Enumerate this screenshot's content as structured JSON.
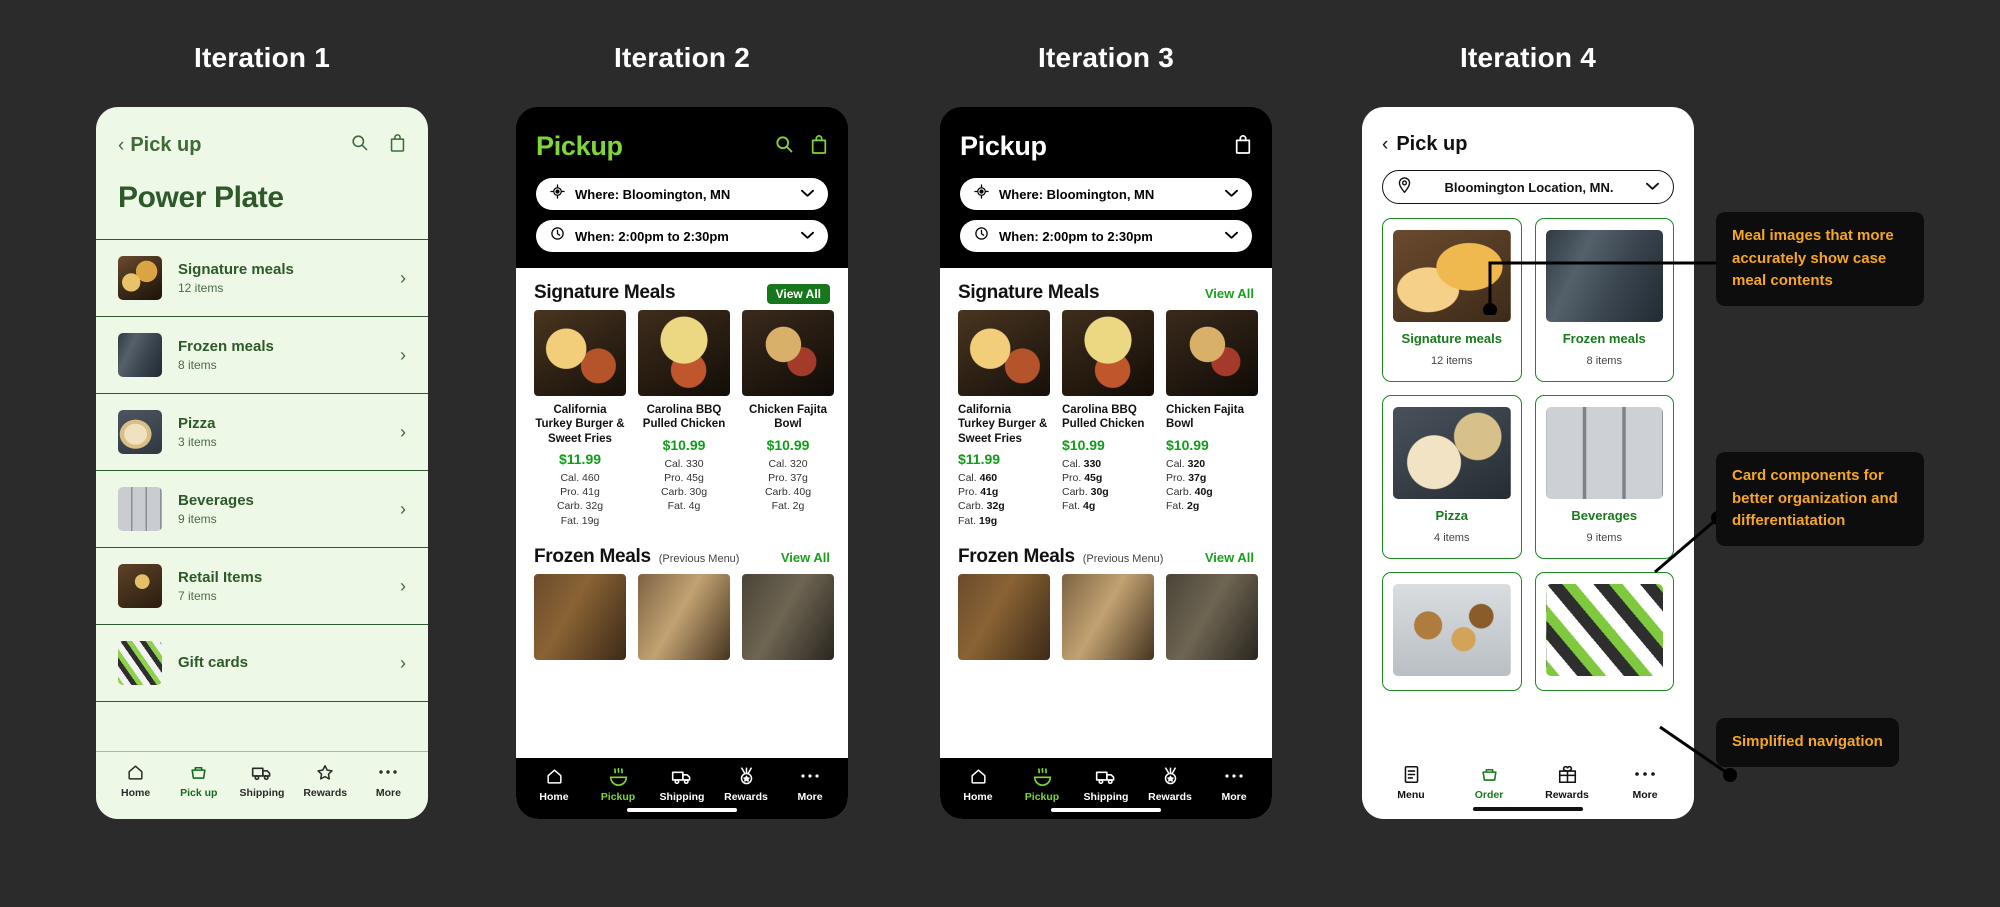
{
  "board": {
    "background": "#2b2b2b",
    "accent_orange": "#f5a623",
    "accent_green": "#7ed638",
    "titles": [
      {
        "label": "Iteration 1"
      },
      {
        "label": "Iteration 2"
      },
      {
        "label": "Iteration 3"
      },
      {
        "label": "Iteration 4"
      }
    ]
  },
  "iteration1": {
    "back_chevron": "‹",
    "back_label": "Pick up",
    "search_icon": "search-icon",
    "bag_icon": "shopping-bag-icon",
    "page_title": "Power Plate",
    "rows": [
      {
        "title": "Signature meals",
        "sub": "12 items",
        "arrow": "›",
        "thumb": "img-sig1"
      },
      {
        "title": "Frozen meals",
        "sub": "8 items",
        "arrow": "›",
        "thumb": "img-froz"
      },
      {
        "title": "Pizza",
        "sub": "3 items",
        "arrow": "›",
        "thumb": "img-pizza"
      },
      {
        "title": "Beverages",
        "sub": "9 items",
        "arrow": "›",
        "thumb": "img-bev"
      },
      {
        "title": "Retail Items",
        "sub": "7 items",
        "arrow": "›",
        "thumb": "img-retail"
      },
      {
        "title": "Gift cards",
        "sub": "",
        "arrow": "›",
        "thumb": "img-gift"
      }
    ],
    "nav": [
      {
        "label": "Home",
        "icon": "home-icon",
        "active": false
      },
      {
        "label": "Pick up",
        "icon": "basket-icon",
        "active": true
      },
      {
        "label": "Shipping",
        "icon": "truck-icon",
        "active": false
      },
      {
        "label": "Rewards",
        "icon": "star-icon",
        "active": false
      },
      {
        "label": "More",
        "icon": "ellipsis-icon",
        "active": false
      }
    ]
  },
  "iteration2": {
    "title": "Pickup",
    "title_color": "#7ed638",
    "search_icon": "search-icon",
    "bag_icon": "shopping-bag-icon",
    "where_icon": "location-target-icon",
    "where_text": "Where: Bloomington, MN",
    "when_icon": "clock-icon",
    "when_text": "When: 2:00pm to 2:30pm",
    "chevron": "⌄",
    "section1": {
      "title": "Signature Meals",
      "view_all": "View All",
      "products": [
        {
          "name": "California Turkey Burger & Sweet Fries",
          "price": "$11.99",
          "cal": "Cal. 460",
          "pro": "Pro. 41g",
          "carb": "Carb. 32g",
          "fat": "Fat. 19g",
          "img": "img-meal-a"
        },
        {
          "name": "Carolina BBQ Pulled Chicken",
          "price": "$10.99",
          "cal": "Cal. 330",
          "pro": "Pro. 45g",
          "carb": "Carb. 30g",
          "fat": "Fat.  4g",
          "img": "img-meal-b"
        },
        {
          "name": "Chicken Fajita Bowl",
          "price": "$10.99",
          "cal": "Cal. 320",
          "pro": "Pro. 37g",
          "carb": "Carb. 40g",
          "fat": "Fat. 2g",
          "img": "img-meal-c"
        }
      ]
    },
    "section2": {
      "title": "Frozen Meals",
      "sub": "(Previous Menu)",
      "view_all": "View All",
      "products": [
        {
          "img": "img-fz-a"
        },
        {
          "img": "img-fz-b"
        },
        {
          "img": "img-fz-c"
        }
      ]
    },
    "nav": [
      {
        "label": "Home",
        "icon": "home-icon",
        "active": false
      },
      {
        "label": "Pickup",
        "icon": "hot-meal-icon",
        "active": true
      },
      {
        "label": "Shipping",
        "icon": "truck-icon",
        "active": false
      },
      {
        "label": "Rewards",
        "icon": "medal-icon",
        "active": false
      },
      {
        "label": "More",
        "icon": "ellipsis-icon",
        "active": false
      }
    ]
  },
  "iteration3": {
    "title": "Pickup",
    "title_color": "#ffffff",
    "bag_icon": "shopping-bag-icon",
    "where_icon": "location-target-icon",
    "where_text": "Where: Bloomington, MN",
    "when_icon": "clock-icon",
    "when_text": "When: 2:00pm to 2:30pm",
    "chevron": "⌄",
    "section1": {
      "title": "Signature Meals",
      "view_all": "View All",
      "products": [
        {
          "name": "California Turkey Burger & Sweet Fries",
          "price": "$11.99",
          "cal_label": "Cal.",
          "cal": "460",
          "pro_label": "Pro.",
          "pro": "41g",
          "carb_label": "Carb.",
          "carb": "32g",
          "fat_label": "Fat.",
          "fat": "19g",
          "img": "img-meal-a"
        },
        {
          "name": "Carolina BBQ Pulled Chicken",
          "price": "$10.99",
          "cal_label": "Cal.",
          "cal": "330",
          "pro_label": "Pro.",
          "pro": "45g",
          "carb_label": "Carb.",
          "carb": "30g",
          "fat_label": "Fat.",
          "fat": "4g",
          "img": "img-meal-b"
        },
        {
          "name": "Chicken Fajita Bowl",
          "price": "$10.99",
          "cal_label": "Cal.",
          "cal": "320",
          "pro_label": "Pro.",
          "pro": "37g",
          "carb_label": "Carb.",
          "carb": "40g",
          "fat_label": "Fat.",
          "fat": "2g",
          "img": "img-meal-c"
        }
      ]
    },
    "section2": {
      "title": "Frozen Meals",
      "sub": "(Previous Menu)",
      "view_all": "View All",
      "products": [
        {
          "img": "img-fz-a"
        },
        {
          "img": "img-fz-b"
        },
        {
          "img": "img-fz-c"
        }
      ]
    },
    "nav": [
      {
        "label": "Home",
        "icon": "home-icon",
        "active": false
      },
      {
        "label": "Pickup",
        "icon": "hot-meal-icon",
        "active": true
      },
      {
        "label": "Shipping",
        "icon": "truck-icon",
        "active": false
      },
      {
        "label": "Rewards",
        "icon": "medal-icon",
        "active": false
      },
      {
        "label": "More",
        "icon": "ellipsis-icon",
        "active": false
      }
    ]
  },
  "iteration4": {
    "back_chevron": "‹",
    "back_label": "Pick up",
    "location_icon": "map-pin-icon",
    "location_text": "Bloomington Location, MN.",
    "chevron": "⌄",
    "cards": [
      {
        "title": "Signature meals",
        "sub": "12 items",
        "img": "img-mac"
      },
      {
        "title": "Frozen meals",
        "sub": "8 items",
        "img": "img-froz"
      },
      {
        "title": "Pizza",
        "sub": "4 items",
        "img": "img-pizza2"
      },
      {
        "title": "Beverages",
        "sub": "9 items",
        "img": "img-celsius"
      },
      {
        "title": "",
        "sub": "",
        "img": "img-snack"
      },
      {
        "title": "",
        "sub": "",
        "img": "img-gift2"
      }
    ],
    "nav": [
      {
        "label": "Menu",
        "icon": "menu-list-icon",
        "active": false
      },
      {
        "label": "Order",
        "icon": "basket-icon",
        "active": true
      },
      {
        "label": "Rewards",
        "icon": "gift-icon",
        "active": false
      },
      {
        "label": "More",
        "icon": "ellipsis-icon",
        "active": false
      }
    ]
  },
  "callouts": [
    {
      "text": "Meal images that more accurately show case meal contents"
    },
    {
      "text": "Card components for better organization  and differentiatation"
    },
    {
      "text": "Simplified navigation"
    }
  ]
}
